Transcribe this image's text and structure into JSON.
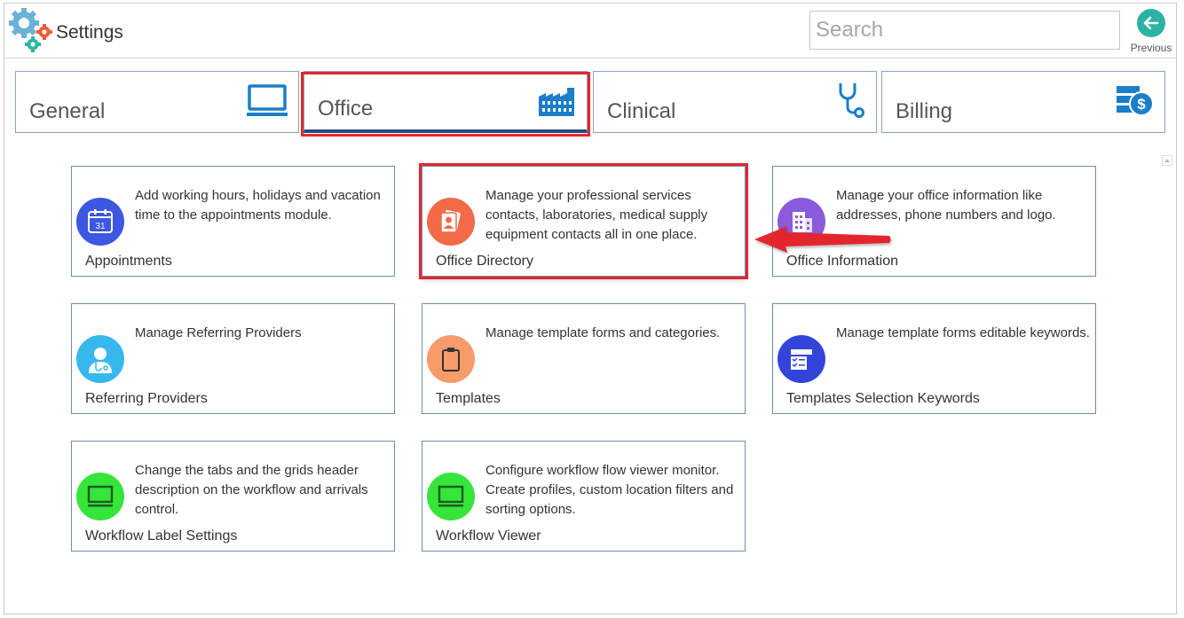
{
  "header": {
    "title": "Settings",
    "logo_icon": "gears-icon",
    "search_placeholder": "Search",
    "search_value": "",
    "previous_label": "Previous",
    "previous_icon": "arrow-left-icon"
  },
  "tabs": [
    {
      "label": "General",
      "icon": "monitor-icon",
      "active": false
    },
    {
      "label": "Office",
      "icon": "factory-icon",
      "active": true
    },
    {
      "label": "Clinical",
      "icon": "stethoscope-icon",
      "active": false
    },
    {
      "label": "Billing",
      "icon": "billing-icon",
      "active": false
    }
  ],
  "cards": [
    {
      "title": "Appointments",
      "description": "Add working hours, holidays and vacation time to the appointments module.",
      "icon": "calendar-icon",
      "icon_color": "#3d57e0",
      "icon_text": "31"
    },
    {
      "title": "Office Directory",
      "description": "Manage your professional services contacts, laboratories, medical supply equipment contacts all in one place.",
      "icon": "contact-book-icon",
      "icon_color": "#f26a46"
    },
    {
      "title": "Office Information",
      "description": "Manage your office information like addresses, phone numbers and logo.",
      "icon": "office-building-icon",
      "icon_color": "#8a5bdc"
    },
    {
      "title": "Referring Providers",
      "description": "Manage Referring Providers",
      "icon": "doctor-icon",
      "icon_color": "#36b8ec"
    },
    {
      "title": "Templates",
      "description": "Manage template forms and categories.",
      "icon": "clipboard-icon",
      "icon_color": "#f79b6b"
    },
    {
      "title": "Templates Selection Keywords",
      "description": "Manage template forms editable keywords.",
      "icon": "form-checklist-icon",
      "icon_color": "#3345d8"
    },
    {
      "title": "Workflow Label Settings",
      "description": "Change the tabs and the grids header description on the workflow and arrivals control.",
      "icon": "monitor-icon",
      "icon_color": "#35e53a"
    },
    {
      "title": "Workflow Viewer",
      "description": "Configure workflow flow viewer monitor. Create profiles, custom location filters and sorting options.",
      "icon": "monitor-icon",
      "icon_color": "#35e53a"
    }
  ],
  "colors": {
    "accent": "#1a7ec8",
    "highlight": "#e3262f",
    "tab_border": "#8aa4c1",
    "card_border": "#6d8db4",
    "active_tab_underline": "#264d7a"
  }
}
